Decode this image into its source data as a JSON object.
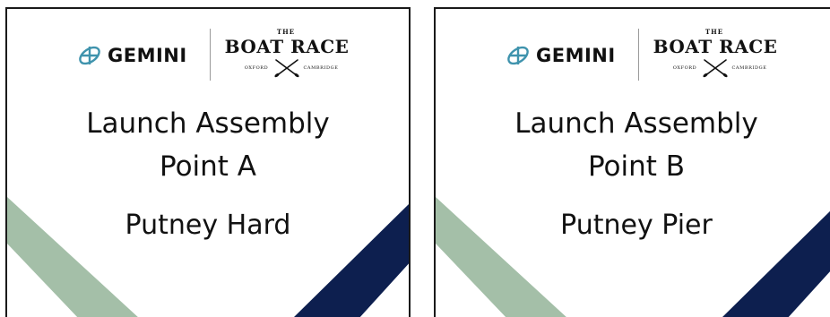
{
  "signs": [
    {
      "sponsor": "GEMINI",
      "event_the": "THE",
      "event_name": "BOAT RACE",
      "oxford": "OXFORD",
      "cambridge": "CAMBRIDGE",
      "title_line1": "Launch Assembly",
      "title_line2": "Point A",
      "location": "Putney Hard"
    },
    {
      "sponsor": "GEMINI",
      "event_the": "THE",
      "event_name": "BOAT RACE",
      "oxford": "OXFORD",
      "cambridge": "CAMBRIDGE",
      "title_line1": "Launch Assembly",
      "title_line2": "Point B",
      "location": "Putney Pier"
    }
  ],
  "colors": {
    "green_stripe": "#a4bfa8",
    "navy_stripe": "#0d1f4f",
    "gemini_icon": "#3f93ad",
    "text": "#111111",
    "border": "#1a1a1a"
  },
  "icons": {
    "sponsor": "gemini-logo-icon",
    "oars": "crossed-oars-icon"
  }
}
